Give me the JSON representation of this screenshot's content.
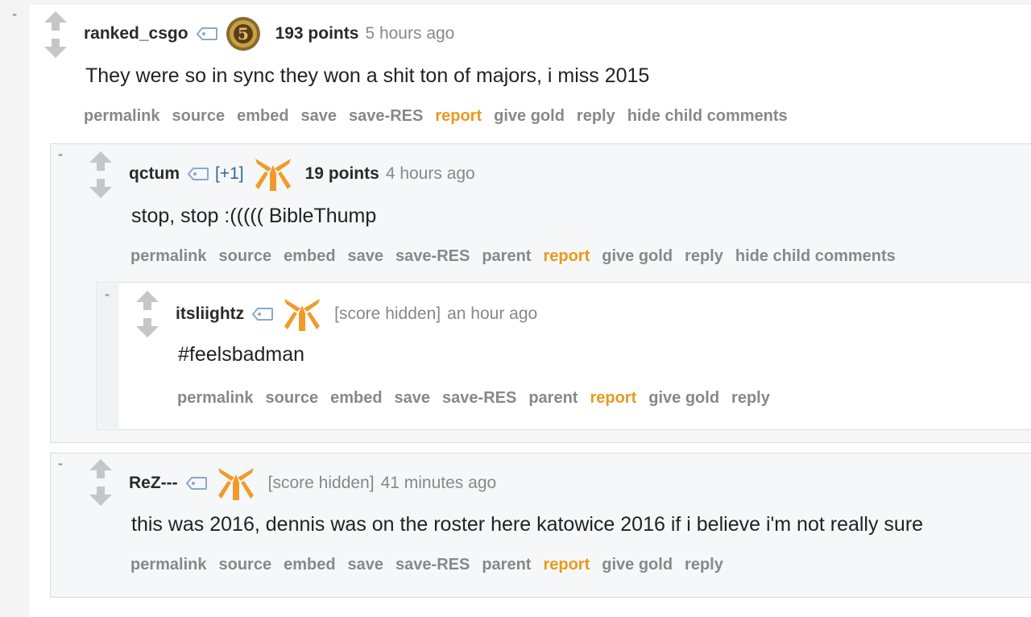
{
  "colors": {
    "report": "#e89a1b",
    "link_gray": "#888888",
    "flair_orange": "#f09a2a",
    "plus": "#336699"
  },
  "collapse_symbol": "-",
  "icons": {
    "vote": "updown-arrows-icon",
    "tag": "user-tag-icon",
    "flair_fnatic": "fnatic-flair-icon",
    "flair_badge": "rank-5-badge-icon"
  },
  "comments": [
    {
      "author": "ranked_csgo",
      "flair_text": "5",
      "points": "193 points",
      "time": "5 hours ago",
      "body": "They were so in sync they won a shit ton of majors, i miss 2015",
      "buttons": [
        "permalink",
        "source",
        "embed",
        "save",
        "save-RES",
        "report",
        "give gold",
        "reply",
        "hide child comments"
      ]
    },
    {
      "author": "qctum",
      "plus": "[+1]",
      "points": "19 points",
      "time": "4 hours ago",
      "body": "stop, stop :((((( BibleThump",
      "buttons": [
        "permalink",
        "source",
        "embed",
        "save",
        "save-RES",
        "parent",
        "report",
        "give gold",
        "reply",
        "hide child comments"
      ]
    },
    {
      "author": "itsliightz",
      "score_hidden": "[score hidden]",
      "time": "an hour ago",
      "body": "#feelsbadman",
      "buttons": [
        "permalink",
        "source",
        "embed",
        "save",
        "save-RES",
        "parent",
        "report",
        "give gold",
        "reply"
      ]
    },
    {
      "author": "ReZ---",
      "score_hidden": "[score hidden]",
      "time": "41 minutes ago",
      "body": "this was 2016, dennis was on the roster here katowice 2016 if i believe i'm not really sure",
      "buttons": [
        "permalink",
        "source",
        "embed",
        "save",
        "save-RES",
        "parent",
        "report",
        "give gold",
        "reply"
      ]
    }
  ]
}
